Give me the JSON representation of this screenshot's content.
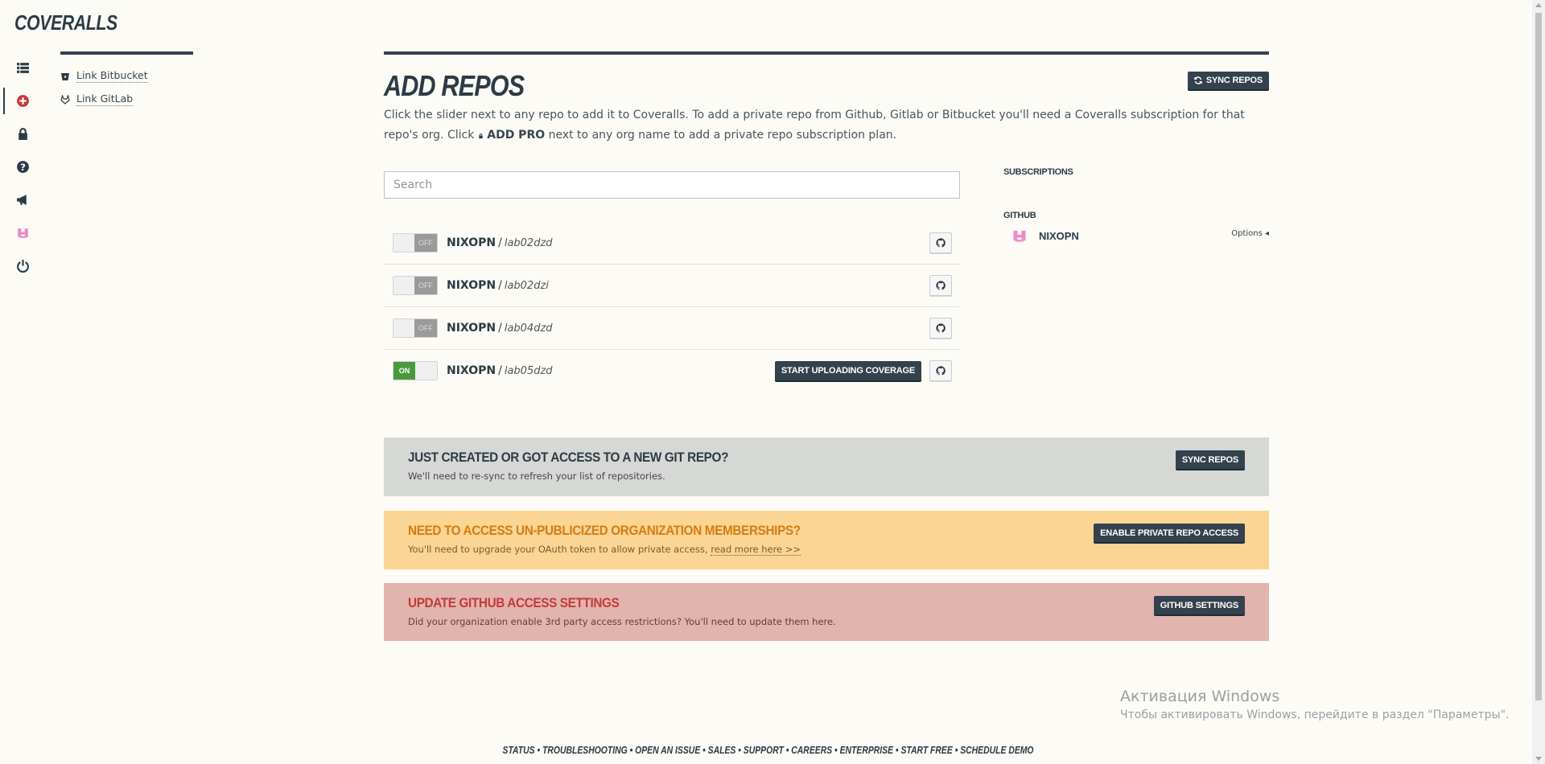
{
  "app": {
    "logo": "COVERALLS"
  },
  "rail": {
    "items": [
      {
        "icon": "list-icon",
        "active": false
      },
      {
        "icon": "add-circle-icon",
        "active": true,
        "color": "#c4393b"
      },
      {
        "icon": "lock-icon",
        "active": false
      },
      {
        "icon": "help-icon",
        "active": false
      },
      {
        "icon": "megaphone-icon",
        "active": false
      },
      {
        "icon": "avatar-icon",
        "active": false
      },
      {
        "icon": "power-icon",
        "active": false
      }
    ]
  },
  "subnav": {
    "items": [
      {
        "icon": "bitbucket-icon",
        "label": "Link Bitbucket"
      },
      {
        "icon": "gitlab-icon",
        "label": "Link GitLab"
      }
    ]
  },
  "main": {
    "title": "ADD REPOS",
    "sync_label": "SYNC REPOS",
    "intro_text": "Click the slider next to any repo to add it to Coveralls. To add a private repo from Github, Gitlab or Bitbucket you'll need a Coveralls subscription for that repo's org. Click",
    "intro_bold": "ADD PRO",
    "intro_tail": "next to any org name to add a private repo subscription plan.",
    "search_placeholder": "Search"
  },
  "repos": [
    {
      "org": "NIXOPN",
      "name": "lab02dzd",
      "state": "OFF",
      "enabled": false
    },
    {
      "org": "NIXOPN",
      "name": "lab02dzi",
      "state": "OFF",
      "enabled": false
    },
    {
      "org": "NIXOPN",
      "name": "lab04dzd",
      "state": "OFF",
      "enabled": false
    },
    {
      "org": "NIXOPN",
      "name": "lab05dzd",
      "state": "ON",
      "enabled": true,
      "action_label": "START UPLOADING COVERAGE"
    }
  ],
  "sidebar": {
    "subscriptions_heading": "SUBSCRIPTIONS",
    "github_heading": "GITHUB",
    "org_name": "NIXOPN",
    "options_label": "Options ◂"
  },
  "banners": {
    "sync": {
      "title": "JUST CREATED OR GOT ACCESS TO A NEW GIT REPO?",
      "text": "We'll need to re-sync to refresh your list of repositories.",
      "button": "SYNC REPOS"
    },
    "private": {
      "title": "NEED TO ACCESS UN-PUBLICIZED ORGANIZATION MEMBERSHIPS?",
      "text": "You'll need to upgrade your OAuth token to allow private access,",
      "link": "read more here >>",
      "button": "ENABLE PRIVATE REPO ACCESS"
    },
    "settings": {
      "title": "UPDATE GITHUB ACCESS SETTINGS",
      "text": "Did your organization enable 3rd party access restrictions? You'll need to update them here.",
      "button": "GITHUB SETTINGS"
    }
  },
  "watermark": {
    "line1": "Активация Windows",
    "line2": "Чтобы активировать Windows, перейдите в раздел \"Параметры\"."
  },
  "footer": {
    "links": [
      "STATUS",
      "TROUBLESHOOTING",
      "OPEN AN ISSUE",
      "SALES",
      "SUPPORT",
      "CAREERS",
      "ENTERPRISE",
      "START FREE",
      "SCHEDULE DEMO"
    ],
    "separator": " • "
  }
}
